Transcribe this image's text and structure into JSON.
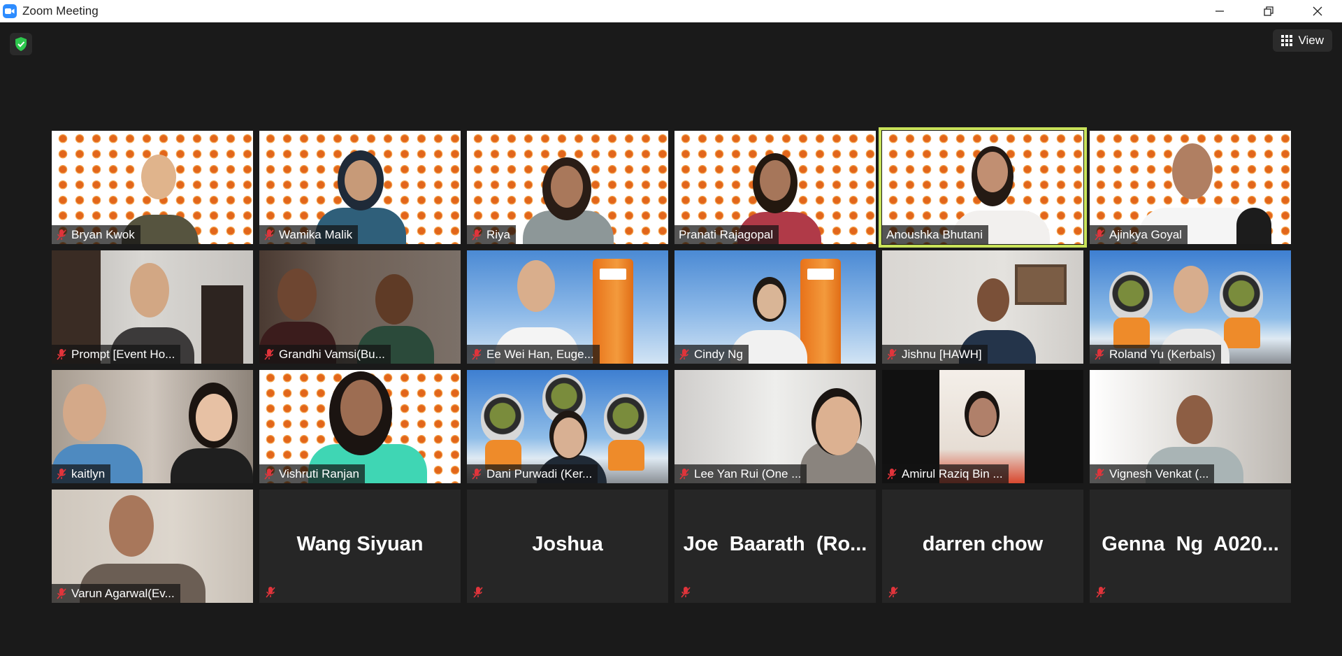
{
  "window": {
    "title": "Zoom Meeting"
  },
  "toolbar": {
    "view_label": "View"
  },
  "colors": {
    "active_speaker": "#c9e35a",
    "mute": "#e0343b",
    "security": "#2dc84d"
  },
  "participants": [
    {
      "name": "Bryan Kwok"
    },
    {
      "name": "Wamika Malik"
    },
    {
      "name": "Riya"
    },
    {
      "name": "Pranati Rajagopal"
    },
    {
      "name": "Anoushka Bhutani"
    },
    {
      "name": "Ajinkya Goyal"
    },
    {
      "name": "Prompt [Event Ho..."
    },
    {
      "name": "Grandhi Vamsi(Bu..."
    },
    {
      "name": "Ee Wei Han, Euge..."
    },
    {
      "name": "Cindy Ng"
    },
    {
      "name": "Jishnu [HAWH]"
    },
    {
      "name": "Roland Yu (Kerbals)"
    },
    {
      "name": "kaitlyn"
    },
    {
      "name": "Vishruti Ranjan"
    },
    {
      "name": "Dani Purwadi (Ker..."
    },
    {
      "name": "Lee Yan Rui (One ..."
    },
    {
      "name": "Amirul Raziq Bin ..."
    },
    {
      "name": "Vignesh Venkat (..."
    },
    {
      "name": "Varun Agarwal(Ev..."
    },
    {
      "name": "Wang Siyuan"
    },
    {
      "name": "Joshua"
    },
    {
      "name": "Joe  Baarath  (Ro..."
    },
    {
      "name": "darren chow"
    },
    {
      "name": "Genna  Ng  A020..."
    }
  ]
}
